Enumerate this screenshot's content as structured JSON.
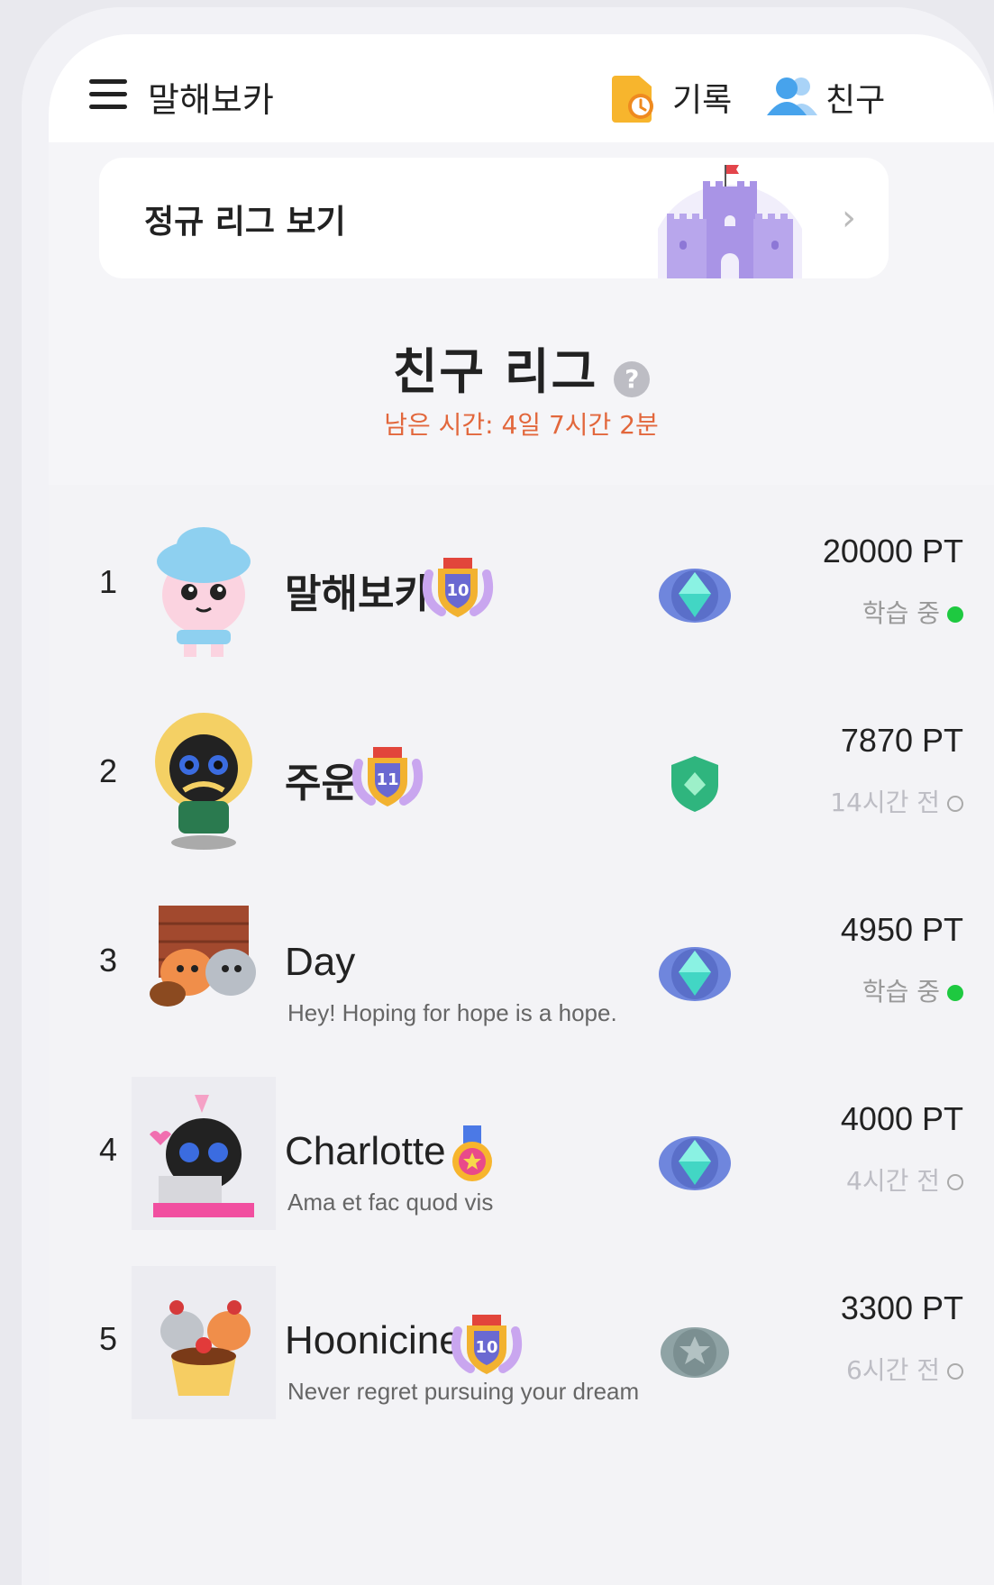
{
  "header": {
    "app_title": "말해보카",
    "record_label": "기록",
    "friends_label": "친구"
  },
  "league_card": {
    "label": "정규 리그 보기"
  },
  "league": {
    "title": "친구 리그",
    "time_left": "남은 시간: 4일 7시간 2분"
  },
  "rows": [
    {
      "rank": "1",
      "name": "말해보카",
      "badge_level": "10",
      "status_message": "",
      "points": "20000 PT",
      "activity": "학습 중",
      "online": true,
      "tier": "diamond"
    },
    {
      "rank": "2",
      "name": "주운",
      "badge_level": "11",
      "status_message": "",
      "points": "7870 PT",
      "activity": "14시간 전",
      "online": false,
      "tier": "emerald"
    },
    {
      "rank": "3",
      "name": "Day",
      "badge_level": "",
      "status_message": "Hey! Hoping for hope is a hope.",
      "points": "4950 PT",
      "activity": "학습 중",
      "online": true,
      "tier": "diamond"
    },
    {
      "rank": "4",
      "name": "Charlotte",
      "badge_level": "",
      "status_message": "Ama et fac quod vis",
      "points": "4000 PT",
      "activity": "4시간 전",
      "online": false,
      "tier": "diamond"
    },
    {
      "rank": "5",
      "name": "Hoonicine",
      "badge_level": "10",
      "status_message": "Never regret pursuing your dream",
      "points": "3300 PT",
      "activity": "6시간 전",
      "online": false,
      "tier": "silver"
    }
  ],
  "colors": {
    "accent_orange": "#e2673c",
    "online_green": "#1ec940",
    "castle_purple": "#a994e6"
  }
}
